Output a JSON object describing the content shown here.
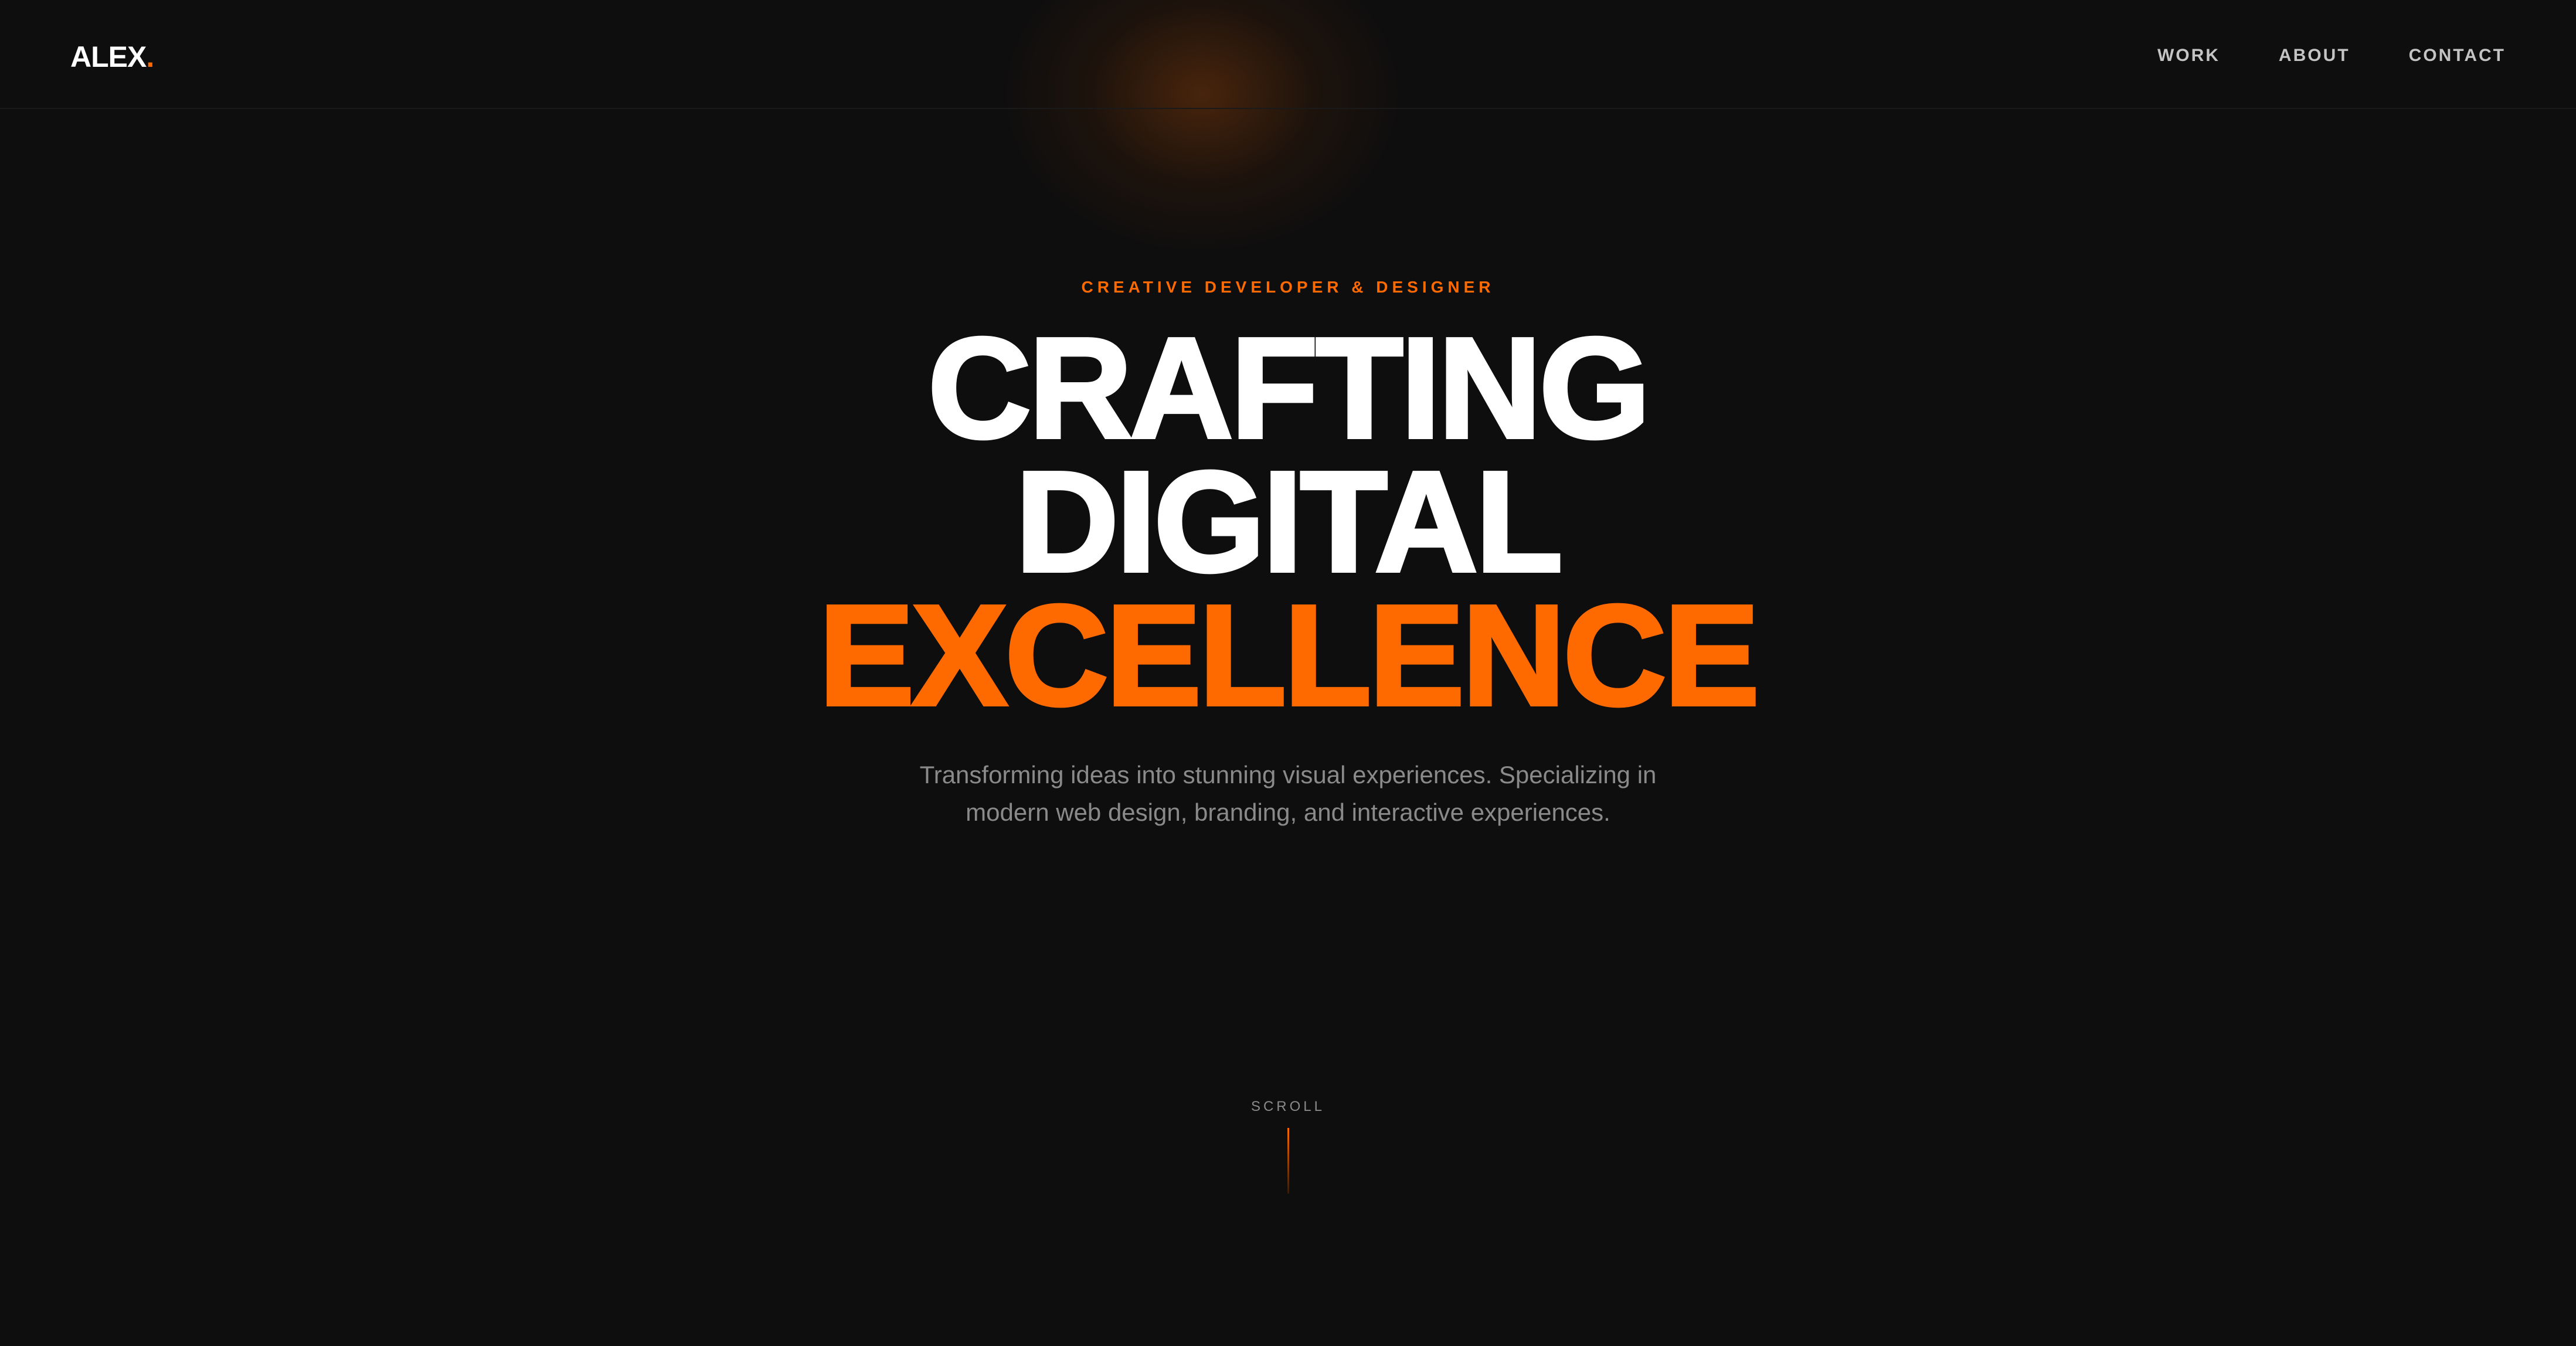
{
  "brand": {
    "name": "ALEX",
    "dot": ".",
    "accent_color": "#ff6a00"
  },
  "nav": {
    "items": [
      {
        "label": "WORK"
      },
      {
        "label": "ABOUT"
      },
      {
        "label": "CONTACT"
      }
    ]
  },
  "hero": {
    "eyebrow": "CREATIVE DEVELOPER & DESIGNER",
    "headline": {
      "line1": "CRAFTING",
      "line2": "DIGITAL",
      "line3": "EXCELLENCE"
    },
    "subtitle": "Transforming ideas into stunning visual experiences. Specializing in modern web design, branding, and interactive experiences."
  },
  "scroll_indicator": {
    "label": "SCROLL"
  },
  "colors": {
    "background": "#0e0e0e",
    "accent": "#ff6a00",
    "text_primary": "#ffffff",
    "text_muted": "#8a8a8a"
  }
}
